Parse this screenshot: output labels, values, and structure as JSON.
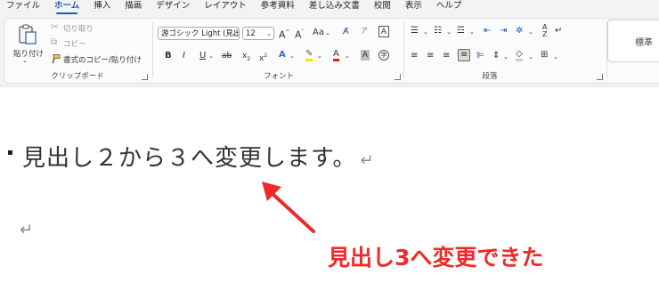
{
  "tabs": [
    "ファイル",
    "ホーム",
    "挿入",
    "描画",
    "デザイン",
    "レイアウト",
    "参考資料",
    "差し込み文書",
    "校閲",
    "表示",
    "ヘルプ"
  ],
  "active_tab": "ホーム",
  "clipboard": {
    "paste_label": "貼り付け",
    "cut_label": "切り取り",
    "copy_label": "コピー",
    "format_painter_label": "書式のコピー/貼り付け",
    "group_label": "クリップボード"
  },
  "font": {
    "font_name": "游ゴシック Light (見出",
    "font_size": "12",
    "case_label": "Aa",
    "group_label": "フォント"
  },
  "paragraph": {
    "group_label": "段落"
  },
  "styles": {
    "preview_label": "標準"
  },
  "document": {
    "heading": "見出し２から３へ変更します。",
    "paragraph_mark": "↵"
  },
  "annotation": {
    "text": "見出し3へ変更できた",
    "color": "#ee2a2a"
  }
}
